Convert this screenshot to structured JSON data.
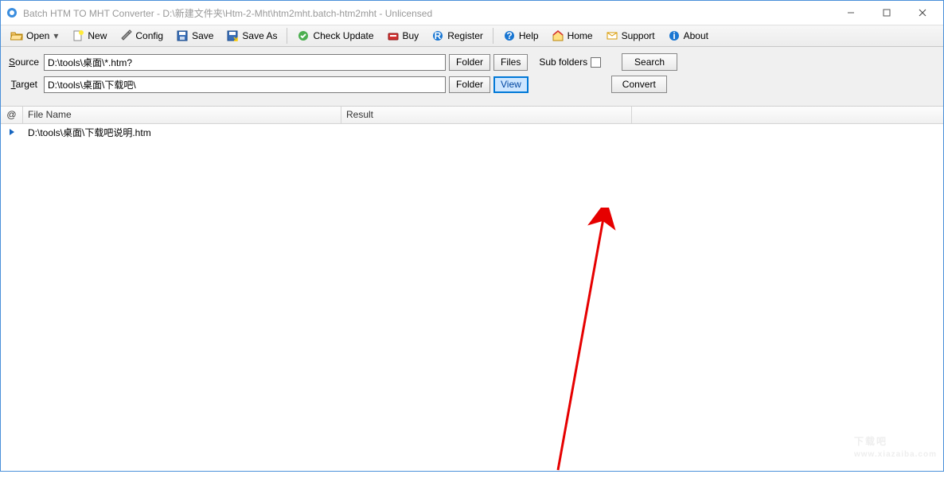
{
  "window": {
    "title": "Batch HTM TO MHT Converter - D:\\新建文件夹\\Htm-2-Mht\\htm2mht.batch-htm2mht - Unlicensed"
  },
  "toolbar": {
    "open": "Open",
    "new": "New",
    "config": "Config",
    "save": "Save",
    "saveAs": "Save As",
    "checkUpdate": "Check Update",
    "buy": "Buy",
    "register": "Register",
    "help": "Help",
    "home": "Home",
    "support": "Support",
    "about": "About"
  },
  "form": {
    "sourceLabelPrefix": "S",
    "sourceLabelRest": "ource",
    "sourceValue": "D:\\tools\\桌面\\*.htm?",
    "targetLabelPrefix": "T",
    "targetLabelRest": "arget",
    "targetValue": "D:\\tools\\桌面\\下载吧\\",
    "folderBtn": "Folder",
    "filesBtn": "Files",
    "viewBtn": "View",
    "subFoldersLabel": "Sub folders",
    "searchBtn": "Search",
    "convertBtn": "Convert"
  },
  "grid": {
    "col0": "@",
    "col1": "File Name",
    "col2": "Result",
    "rows": [
      {
        "file": "D:\\tools\\桌面\\下载吧说明.htm"
      }
    ]
  },
  "watermark": {
    "big": "下载吧",
    "small": "www.xiazaiba.com"
  }
}
